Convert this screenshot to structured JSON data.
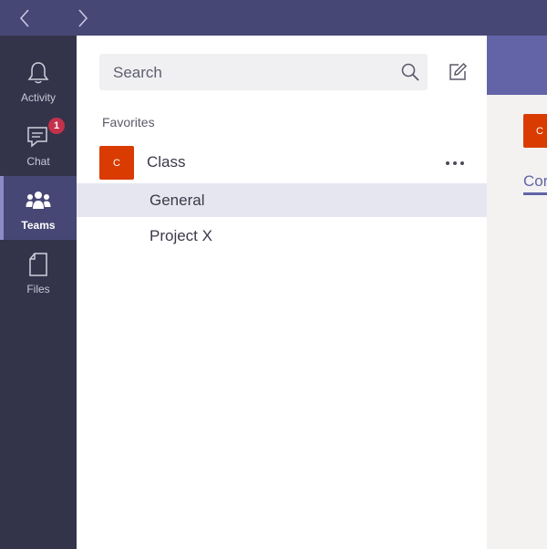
{
  "nav": {
    "back_icon": "chevron-left-icon",
    "forward_icon": "chevron-right-icon"
  },
  "rail": {
    "items": [
      {
        "label": "Activity",
        "icon": "bell-icon"
      },
      {
        "label": "Chat",
        "icon": "chat-icon",
        "badge": "1"
      },
      {
        "label": "Teams",
        "icon": "teams-icon",
        "active": true
      },
      {
        "label": "Files",
        "icon": "file-icon"
      }
    ]
  },
  "panel": {
    "search_placeholder": "Search",
    "favorites_label": "Favorites",
    "team": {
      "initial": "C",
      "name": "Class"
    },
    "channels": [
      {
        "name": "General",
        "selected": true
      },
      {
        "name": "Project X"
      }
    ]
  },
  "content": {
    "avatar_initial": "C",
    "tab_label": "Cor"
  },
  "colors": {
    "topbar": "#464775",
    "rail": "#33344a",
    "accent": "#6264a7",
    "avatar": "#da3b01",
    "badge": "#c4314b"
  }
}
